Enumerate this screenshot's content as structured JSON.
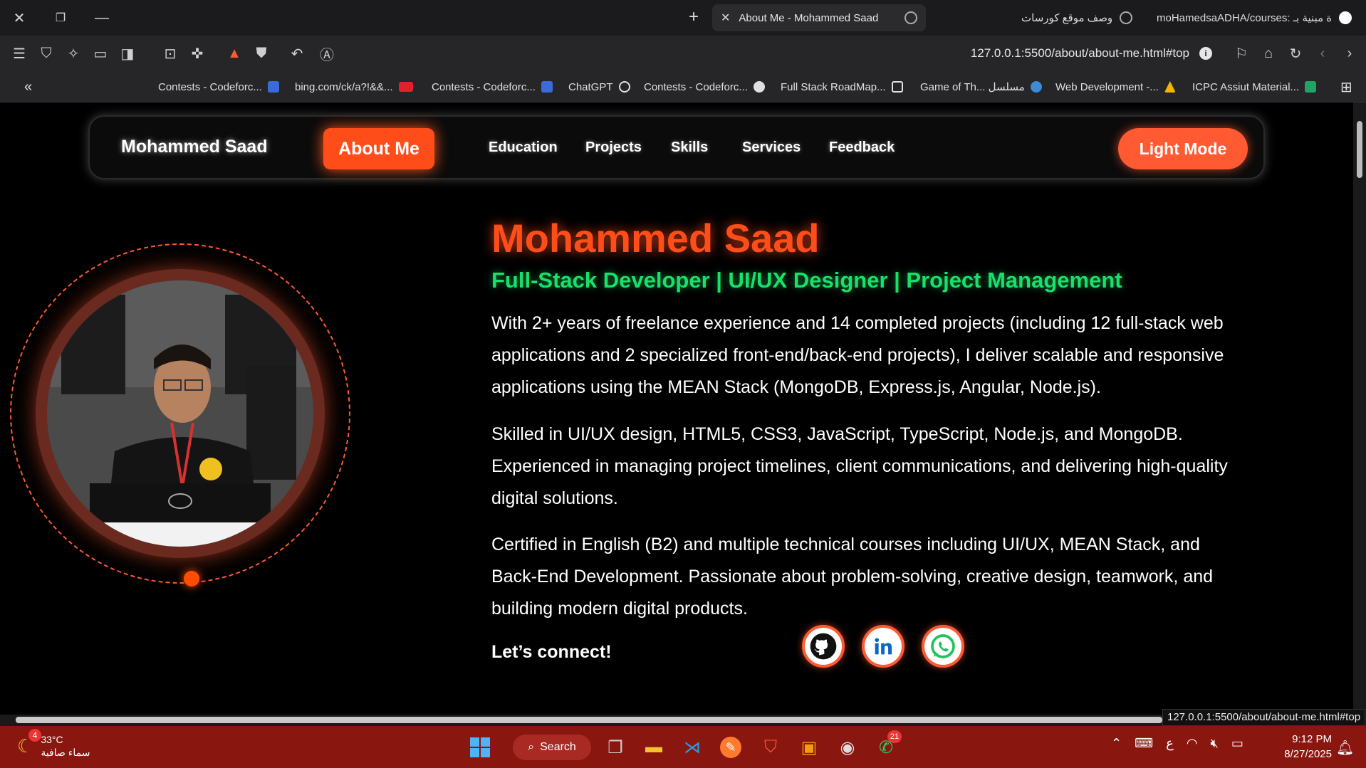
{
  "browser": {
    "active_tab": {
      "title": "About Me - Mohammed Saad"
    },
    "other_tabs": [
      {
        "title": "وصف موقع كورسات"
      },
      {
        "title": "moHamedsaADHA/courses: ة مبنية بـ"
      }
    ],
    "url": "127.0.0.1:5500/about/about-me.html#top",
    "bookmarks": [
      {
        "label": "Contests - Codeforc...",
        "color": "#3b6bd6"
      },
      {
        "label": "bing.com/ck/a?!&&...",
        "color": "#e0202a"
      },
      {
        "label": "Contests - Codeforc...",
        "color": "#3b6bd6"
      },
      {
        "label": "ChatGPT",
        "color": "#e0e0e0"
      },
      {
        "label": "Contests - Codeforc...",
        "color": "#e0e0e0"
      },
      {
        "label": "Full Stack RoadMap...",
        "color": "#e0e0e0"
      },
      {
        "label": "Game of Th... مسلسل",
        "color": "#3b8bd6"
      },
      {
        "label": "Web Development -...",
        "color": "#1fa463"
      },
      {
        "label": "ICPC Assiut Material...",
        "color": "#21a366"
      }
    ]
  },
  "navbar": {
    "brand": "Mohammed Saad",
    "active": "About Me",
    "links": [
      "Education",
      "Projects",
      "Skills",
      "Services",
      "Feedback"
    ],
    "theme_toggle": "Light Mode"
  },
  "hero": {
    "name": "Mohammed Saad",
    "role": "Full-Stack Developer | UI/UX Designer | Project Management",
    "paragraphs": [
      "With 2+ years of freelance experience and 14 completed projects (including 12 full-stack web applications and 2 specialized front-end/back-end projects), I deliver scalable and responsive applications using the MEAN Stack (MongoDB, Express.js, Angular, Node.js).",
      "Skilled in UI/UX design, HTML5, CSS3, JavaScript, TypeScript, Node.js, and MongoDB. Experienced in managing project timelines, client communications, and delivering high-quality digital solutions.",
      "Certified in English (B2) and multiple technical courses including UI/UX, MEAN Stack, and Back-End Development. Passionate about problem-solving, creative design, teamwork, and building modern digital products."
    ],
    "connect": "Let’s connect!",
    "socials": [
      "github-icon",
      "linkedin-icon",
      "whatsapp-icon"
    ]
  },
  "status_url": "127.0.0.1:5500/about/about-me.html#top",
  "taskbar": {
    "weather": {
      "temp": "33°C",
      "desc": "سماء صافية",
      "badge": "4"
    },
    "search": "Search",
    "whatsapp_badge": "21",
    "lang": "ع",
    "time": "9:12 PM",
    "date": "8/27/2025"
  },
  "colors": {
    "accent": "#ff4d1a",
    "role_green": "#19e06b",
    "taskbar": "#8a1610"
  }
}
